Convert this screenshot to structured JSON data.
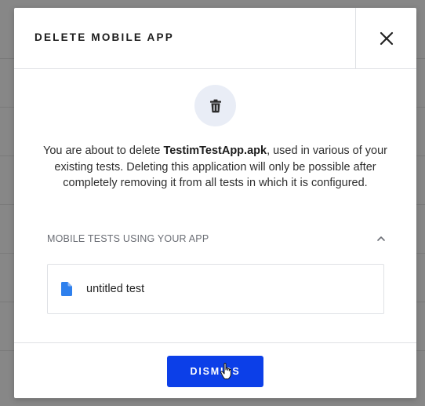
{
  "modal": {
    "title": "DELETE MOBILE APP",
    "close_icon": "close-icon",
    "trash_icon": "trash-icon",
    "message": {
      "prefix": "You are about to delete ",
      "app_name": "TestimTestApp.apk",
      "suffix": ", used in various of your existing tests. Deleting this application will only be possible after completely removing it from all tests in which it is configured."
    },
    "section": {
      "title": "MOBILE TESTS USING YOUR APP",
      "collapse_icon": "chevron-up-icon",
      "items": [
        {
          "label": "untitled test",
          "icon": "document-icon"
        }
      ]
    },
    "dismiss_label": "DISMISS"
  },
  "colors": {
    "primary": "#0c3fe8",
    "icon_blue": "#2f80ed",
    "overlay": "#878787"
  }
}
